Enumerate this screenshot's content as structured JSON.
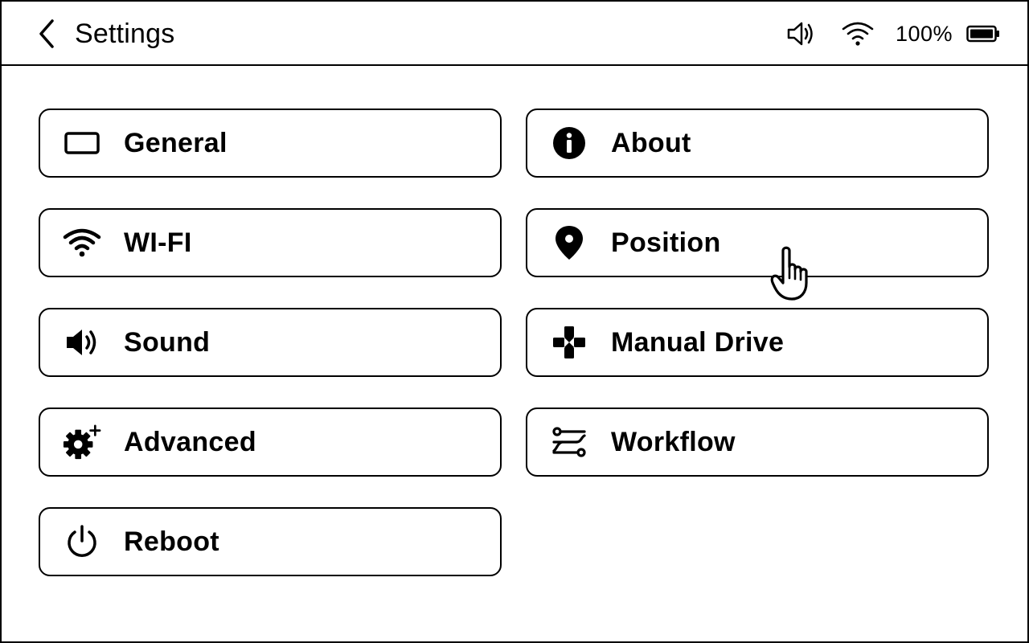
{
  "header": {
    "title": "Settings",
    "back_icon": "chevron-left-icon",
    "status": {
      "volume_icon": "speaker-icon",
      "wifi_icon": "wifi-icon",
      "battery_percent": "100%",
      "battery_icon": "battery-full-icon"
    }
  },
  "menu": {
    "items": [
      {
        "label": "General",
        "icon": "display-icon"
      },
      {
        "label": "About",
        "icon": "info-icon"
      },
      {
        "label": "WI-FI",
        "icon": "wifi-icon"
      },
      {
        "label": "Position",
        "icon": "location-pin-icon"
      },
      {
        "label": "Sound",
        "icon": "speaker-icon"
      },
      {
        "label": "Manual Drive",
        "icon": "gamepad-icon"
      },
      {
        "label": "Advanced",
        "icon": "gear-plus-icon"
      },
      {
        "label": "Workflow",
        "icon": "sliders-icon"
      },
      {
        "label": "Reboot",
        "icon": "power-icon"
      }
    ]
  },
  "pointer": {
    "icon": "hand-pointer-icon"
  }
}
